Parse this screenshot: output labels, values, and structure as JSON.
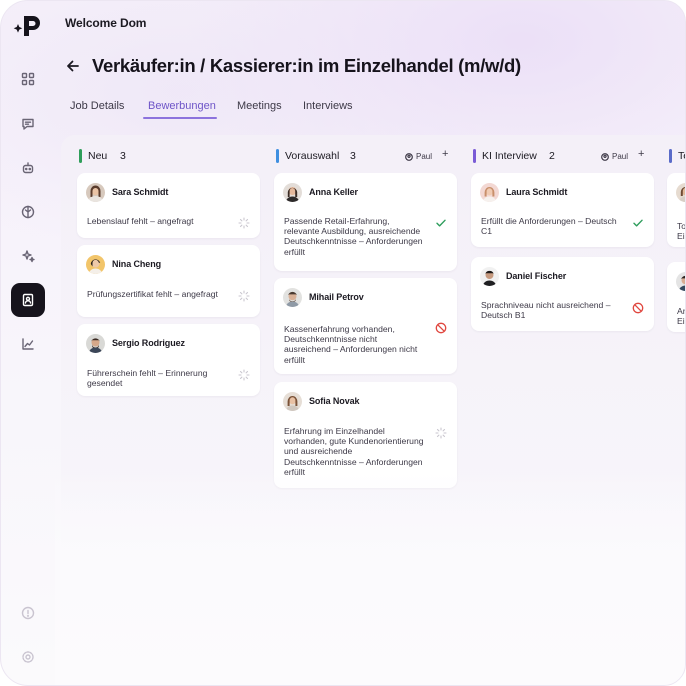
{
  "header": {
    "welcome": "Welcome Dom",
    "title": "Verkäufer:in / Kassierer:in im Einzelhandel (m/w/d)"
  },
  "sidebar": {
    "items": [
      {
        "icon": "grid-icon"
      },
      {
        "icon": "message-icon"
      },
      {
        "icon": "robot-icon"
      },
      {
        "icon": "globe-icon"
      },
      {
        "icon": "sparkle-icon"
      },
      {
        "icon": "candidates-icon",
        "active": true
      },
      {
        "icon": "chart-icon"
      },
      {
        "icon": "help-icon"
      },
      {
        "icon": "settings-icon"
      }
    ]
  },
  "tabs": [
    {
      "label": "Job Details"
    },
    {
      "label": "Bewerbungen",
      "active": true
    },
    {
      "label": "Meetings"
    },
    {
      "label": "Interviews"
    }
  ],
  "columns": [
    {
      "title": "Neu",
      "count": "3",
      "color": "#2f9e5a",
      "cards": [
        {
          "name": "Sara Schmidt",
          "note": "Lebenslauf fehlt – angefragt",
          "status": "pending"
        },
        {
          "name": "Nina Cheng",
          "note": "Prüfungszertifikat fehlt – angefragt",
          "status": "pending"
        },
        {
          "name": "Sergio Rodriguez",
          "note": "Führerschein fehlt – Erinnerung gesendet",
          "status": "pending"
        }
      ]
    },
    {
      "title": "Vorauswahl",
      "count": "3",
      "color": "#3f8fe0",
      "assignee": "Paul",
      "cards": [
        {
          "name": "Anna Keller",
          "note": "Passende Retail-Erfahrung, relevante Ausbildung, ausreichende Deutschkenntnisse – Anforderungen erfüllt",
          "status": "ok"
        },
        {
          "name": "Mihail Petrov",
          "note": "Kassenerfahrung vorhanden, Deutschkenntnisse nicht ausreichend – Anforderungen nicht erfüllt",
          "status": "rejected"
        },
        {
          "name": "Sofia Novak",
          "note": "Erfahrung im Einzelhandel vorhanden, gute Kundenorientierung und ausreichende Deutschkenntnisse – Anforderungen erfüllt",
          "status": "pending"
        }
      ]
    },
    {
      "title": "KI Interview",
      "count": "2",
      "color": "#7a5bd6",
      "assignee": "Paul",
      "cards": [
        {
          "name": "Laura Schmidt",
          "note": "Erfüllt die Anforderungen – Deutsch C1",
          "status": "ok"
        },
        {
          "name": "Daniel Fischer",
          "note": "Sprachniveau nicht ausreichend – Deutsch B1",
          "status": "rejected"
        }
      ]
    },
    {
      "title": "Te",
      "color": "#5a6bc8",
      "cards": [
        {
          "note": "Top\nEin"
        },
        {
          "note": "Anf\nEin"
        }
      ]
    }
  ],
  "colors": {
    "accent": "#6e55c8",
    "ok": "#2e9d5c",
    "rejected": "#e0473f",
    "pending": "#c9c6cf"
  }
}
